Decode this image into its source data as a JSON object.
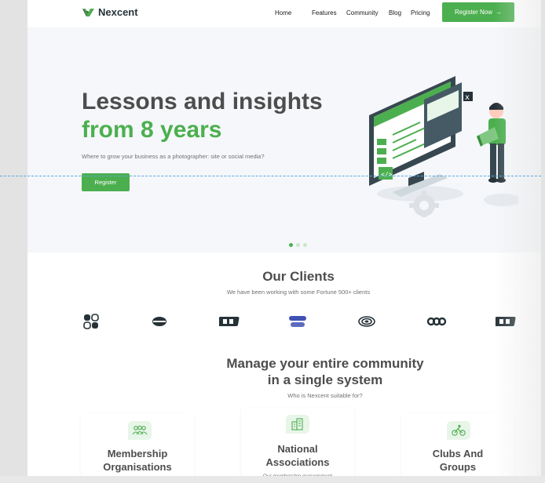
{
  "brand": {
    "name": "Nexcent",
    "color": "#4caf4f"
  },
  "nav": {
    "items": [
      "Home",
      "Features",
      "Community",
      "Blog",
      "Pricing"
    ],
    "cta_label": "Register Now",
    "cta_arrow": "→"
  },
  "hero": {
    "title_line1": "Lessons and insights",
    "title_line2": "from 8 years",
    "subtitle": "Where to grow your business as a photographer: site or social media?",
    "button_label": "Register",
    "carousel": {
      "count": 3,
      "active": 1
    }
  },
  "clients": {
    "title": "Our Clients",
    "subtitle": "We have been working with some Fortune 500+ clients",
    "logos": [
      "client-logo-1",
      "client-logo-2",
      "client-logo-3",
      "client-logo-4",
      "client-logo-5",
      "client-logo-6",
      "client-logo-7"
    ]
  },
  "community": {
    "title_line1": "Manage your entire community",
    "title_line2": "in a single system",
    "subtitle": "Who is Nexcent suitable for?",
    "cards": [
      {
        "title_line1": "Membership",
        "title_line2": "Organisations",
        "icon": "people-group-icon",
        "desc": ""
      },
      {
        "title_line1": "National",
        "title_line2": "Associations",
        "icon": "buildings-icon",
        "desc": "Our membership management"
      },
      {
        "title_line1": "Clubs And",
        "title_line2": "Groups",
        "icon": "cyclist-icon",
        "desc": ""
      }
    ]
  }
}
